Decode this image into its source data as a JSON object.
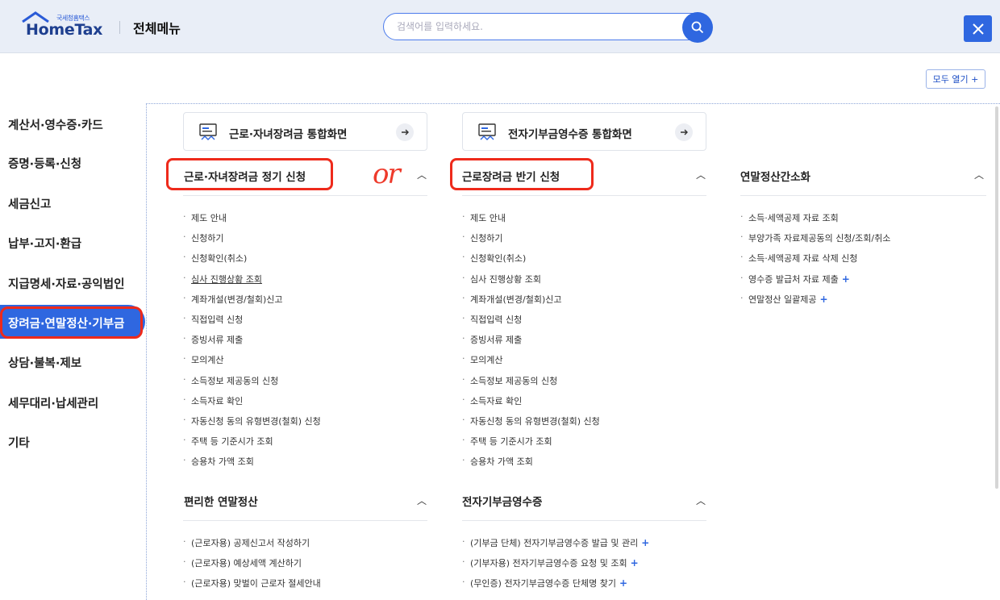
{
  "header": {
    "logo_small": "국세청홈택스",
    "logo_big": "HomeTax",
    "title": "전체메뉴",
    "search_placeholder": "검색어를 입력하세요.",
    "close_icon": "close-icon"
  },
  "open_all": "모두 열기 +",
  "sidebar": {
    "items": [
      {
        "label": "계산서·영수증·카드",
        "active": false
      },
      {
        "label": "증명·등록·신청",
        "active": false
      },
      {
        "label": "세금신고",
        "active": false
      },
      {
        "label": "납부·고지·환급",
        "active": false
      },
      {
        "label": "지급명세·자료·공익법인",
        "active": false
      },
      {
        "label": "장려금·연말정산·기부금",
        "active": true
      },
      {
        "label": "상담·불복·제보",
        "active": false
      },
      {
        "label": "세무대리·납세관리",
        "active": false
      },
      {
        "label": "기타",
        "active": false
      }
    ]
  },
  "cards": [
    {
      "label": "근로·자녀장려금 통합화면"
    },
    {
      "label": "전자기부금영수증 통합화면"
    }
  ],
  "sections": {
    "col1_top": {
      "title": "근로·자녀장려금 정기 신청",
      "items": [
        "제도 안내",
        "신청하기",
        "신청확인(취소)",
        "심사 진행상황 조회",
        "계좌개설(변경/철회)신고",
        "직접입력 신청",
        "증빙서류 제출",
        "모의계산",
        "소득정보 제공동의 신청",
        "소득자료 확인",
        "자동신청 동의 유형변경(철회) 신청",
        "주택 등 기준시가 조회",
        "승용차 가액 조회"
      ]
    },
    "col2_top": {
      "title": "근로장려금 반기 신청",
      "items": [
        "제도 안내",
        "신청하기",
        "신청확인(취소)",
        "심사 진행상황 조회",
        "계좌개설(변경/철회)신고",
        "직접입력 신청",
        "증빙서류 제출",
        "모의계산",
        "소득정보 제공동의 신청",
        "소득자료 확인",
        "자동신청 동의 유형변경(철회) 신청",
        "주택 등 기준시가 조회",
        "승용차 가액 조회"
      ]
    },
    "col3_top": {
      "title": "연말정산간소화",
      "items": [
        "소득·세액공제 자료 조회",
        "부양가족 자료제공동의 신청/조회/취소",
        "소득·세액공제 자료 삭제 신청",
        "영수증 발급처 자료 제출",
        "연말정산 일괄제공"
      ],
      "plus_flags": [
        false,
        false,
        false,
        true,
        true
      ]
    },
    "col1_bottom": {
      "title": "편리한 연말정산",
      "items": [
        "(근로자용) 공제신고서 작성하기",
        "(근로자용) 예상세액 계산하기",
        "(근로자용) 맞벌이 근로자 절세안내"
      ]
    },
    "col2_bottom": {
      "title": "전자기부금영수증",
      "items": [
        "(기부금 단체) 전자기부금영수증 발급 및 관리",
        "(기부자용) 전자기부금영수증 요청 및 조회",
        "(무인증) 전자기부금영수증 단체명 찾기"
      ],
      "plus_flags": [
        true,
        true,
        true
      ]
    }
  },
  "annotation_text": "or",
  "colors": {
    "accent": "#2f67e0",
    "header_bg": "#e9eef7",
    "annotation_red": "#ee2a1b"
  }
}
